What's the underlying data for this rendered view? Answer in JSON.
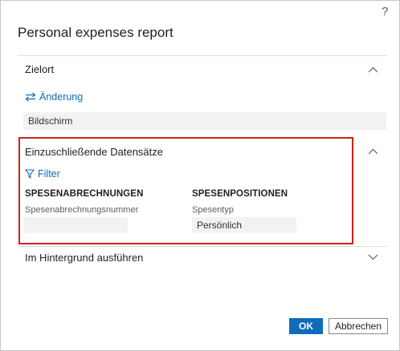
{
  "dialog": {
    "help_label": "?",
    "title": "Personal expenses report"
  },
  "destination": {
    "title": "Zielort",
    "change_link": "Änderung",
    "value": "Bildschirm"
  },
  "records": {
    "title": "Einzuschließende Datensätze",
    "filter_link": "Filter",
    "expense_reports": {
      "heading": "SPESENABRECHNUNGEN",
      "field_label": "Spesenabrechnungsnummer",
      "field_value": ""
    },
    "expense_lines": {
      "heading": "SPESENPOSITIONEN",
      "field_label": "Spesentyp",
      "field_value": "Persönlich"
    }
  },
  "background": {
    "title": "Im Hintergrund ausführen"
  },
  "footer": {
    "ok_label": "OK",
    "cancel_label": "Abbrechen"
  },
  "colors": {
    "accent": "#0f6cbd",
    "highlight_border": "#d1201b",
    "field_background": "#f3f2f1"
  },
  "icons": {
    "chevron_up": "chevron-up-icon",
    "chevron_down": "chevron-down-icon",
    "change": "swap-arrows-icon",
    "filter": "filter-icon"
  }
}
